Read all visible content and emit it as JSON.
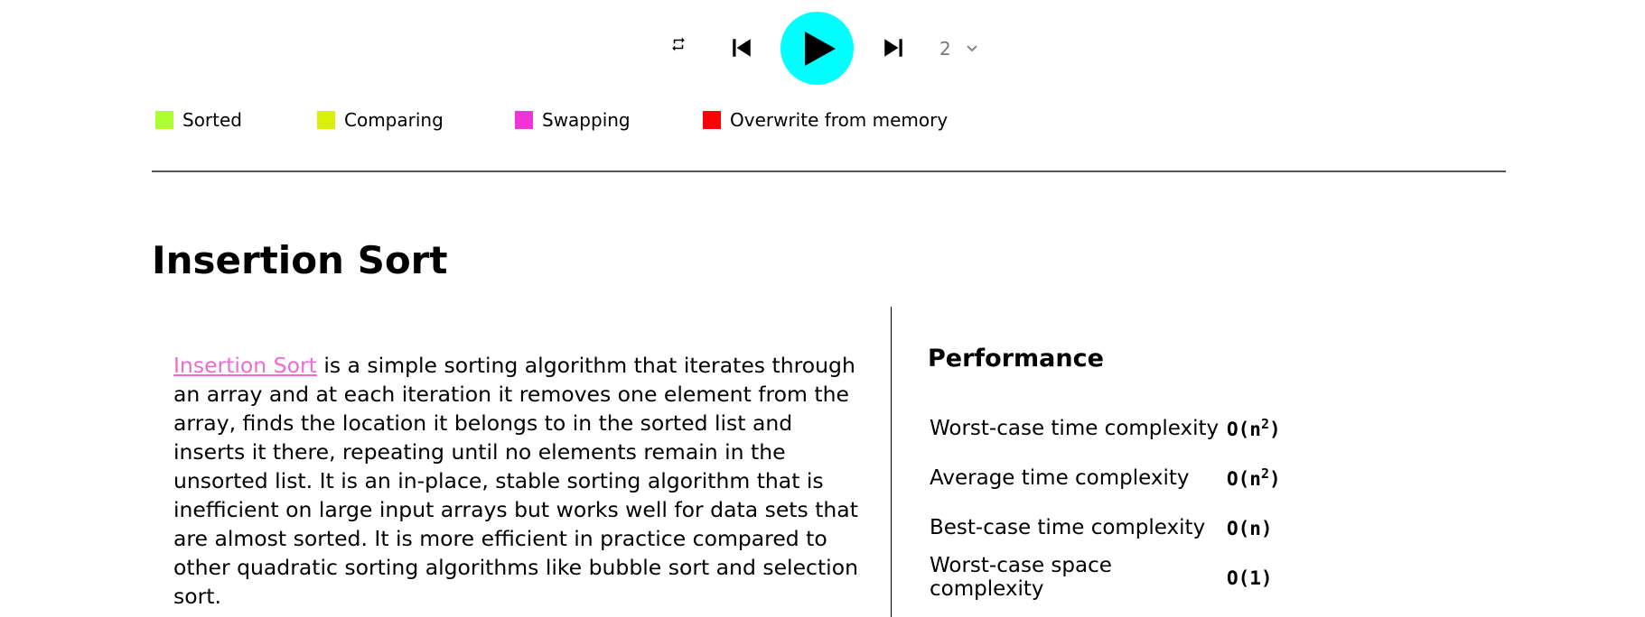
{
  "controls": {
    "repeat_icon": "repeat-icon",
    "prev_icon": "skip-previous-icon",
    "play_icon": "play-icon",
    "next_icon": "skip-next-icon",
    "speed_value": "2",
    "speed_chevron": "chevron-down-icon",
    "play_color": "#00ffff"
  },
  "legend": [
    {
      "label": "Sorted",
      "color": "#adff2f"
    },
    {
      "label": "Comparing",
      "color": "#d9f00a"
    },
    {
      "label": "Swapping",
      "color": "#f233d8"
    },
    {
      "label": "Overwrite from memory",
      "color": "#ff0000"
    }
  ],
  "title": "Insertion Sort",
  "description": {
    "link_text": "Insertion Sort",
    "link_color": "#ef6bd0",
    "text": " is a simple sorting algorithm that iterates through an array and at each iteration it removes one element from the array, finds the location it belongs to in the sorted list and inserts it there, repeating until no elements remain in the unsorted list. It is an in-place, stable sorting algorithm that is inefficient on large input arrays but works well for data sets that are almost sorted. It is more efficient in practice compared to other quadratic sorting algorithms like bubble sort and selection sort."
  },
  "performance": {
    "title": "Performance",
    "rows": [
      {
        "label": "Worst-case time complexity",
        "value": "O(n",
        "sup": "2",
        "close": ")"
      },
      {
        "label": "Average time complexity",
        "value": "O(n",
        "sup": "2",
        "close": ")"
      },
      {
        "label": "Best-case time complexity",
        "value": "O(n)",
        "sup": "",
        "close": ""
      },
      {
        "label": "Worst-case space complexity",
        "value": "O(1)",
        "sup": "",
        "close": ""
      }
    ]
  }
}
